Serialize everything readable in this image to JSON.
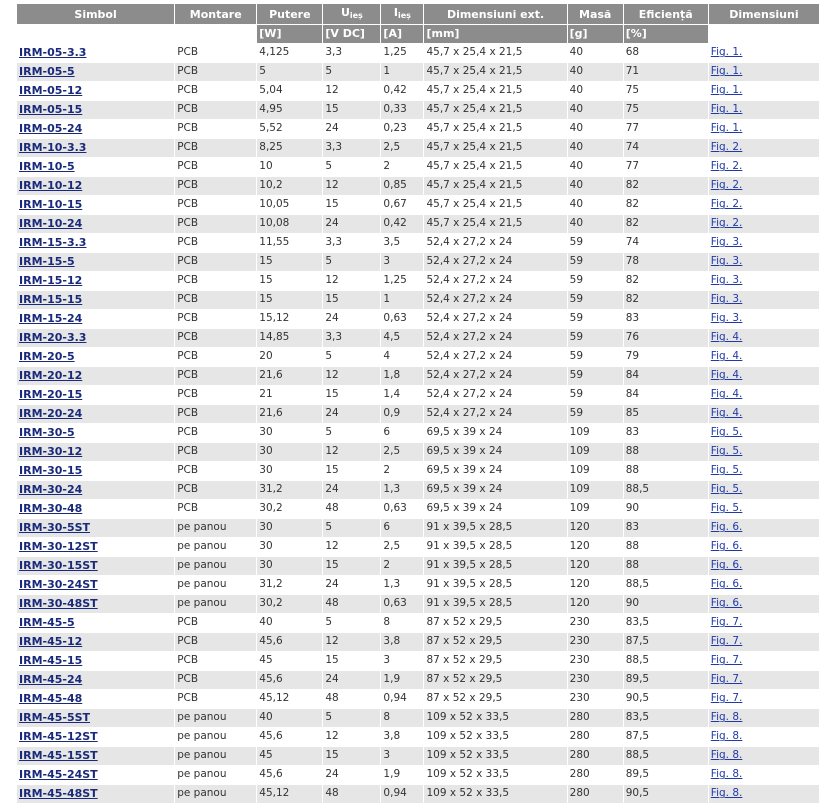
{
  "headers": {
    "simbol": "Simbol",
    "montare": "Montare",
    "putere": "Putere",
    "u_base": "U",
    "u_sub": "ieș",
    "i_base": "I",
    "i_sub": "ieș",
    "dimensiuni_ext": "Dimensiuni ext.",
    "masa": "Masă",
    "eficienta": "Eficiență",
    "dimensiuni": "Dimensiuni"
  },
  "units": {
    "putere": "[W]",
    "u": "[V DC]",
    "i": "[A]",
    "dimensiuni_ext": "[mm]",
    "masa": "[g]",
    "eficienta": "[%]"
  },
  "rows": [
    [
      "IRM-05-3.3",
      "PCB",
      "4,125",
      "3,3",
      "1,25",
      "45,7 x 25,4 x 21,5",
      "40",
      "68",
      "Fig. 1."
    ],
    [
      "IRM-05-5",
      "PCB",
      "5",
      "5",
      "1",
      "45,7 x 25,4 x 21,5",
      "40",
      "71",
      "Fig. 1."
    ],
    [
      "IRM-05-12",
      "PCB",
      "5,04",
      "12",
      "0,42",
      "45,7 x 25,4 x 21,5",
      "40",
      "75",
      "Fig. 1."
    ],
    [
      "IRM-05-15",
      "PCB",
      "4,95",
      "15",
      "0,33",
      "45,7 x 25,4 x 21,5",
      "40",
      "75",
      "Fig. 1."
    ],
    [
      "IRM-05-24",
      "PCB",
      "5,52",
      "24",
      "0,23",
      "45,7 x 25,4 x 21,5",
      "40",
      "77",
      "Fig. 1."
    ],
    [
      "IRM-10-3.3",
      "PCB",
      "8,25",
      "3,3",
      "2,5",
      "45,7 x 25,4 x 21,5",
      "40",
      "74",
      "Fig. 2."
    ],
    [
      "IRM-10-5",
      "PCB",
      "10",
      "5",
      "2",
      "45,7 x 25,4 x 21,5",
      "40",
      "77",
      "Fig. 2."
    ],
    [
      "IRM-10-12",
      "PCB",
      "10,2",
      "12",
      "0,85",
      "45,7 x 25,4 x 21,5",
      "40",
      "82",
      "Fig. 2."
    ],
    [
      "IRM-10-15",
      "PCB",
      "10,05",
      "15",
      "0,67",
      "45,7 x 25,4 x 21,5",
      "40",
      "82",
      "Fig. 2."
    ],
    [
      "IRM-10-24",
      "PCB",
      "10,08",
      "24",
      "0,42",
      "45,7 x 25,4 x 21,5",
      "40",
      "82",
      "Fig. 2."
    ],
    [
      "IRM-15-3.3",
      "PCB",
      "11,55",
      "3,3",
      "3,5",
      "52,4 x 27,2 x 24",
      "59",
      "74",
      "Fig. 3."
    ],
    [
      "IRM-15-5",
      "PCB",
      "15",
      "5",
      "3",
      "52,4 x 27,2 x 24",
      "59",
      "78",
      "Fig. 3."
    ],
    [
      "IRM-15-12",
      "PCB",
      "15",
      "12",
      "1,25",
      "52,4 x 27,2 x 24",
      "59",
      "82",
      "Fig. 3."
    ],
    [
      "IRM-15-15",
      "PCB",
      "15",
      "15",
      "1",
      "52,4 x 27,2 x 24",
      "59",
      "82",
      "Fig. 3."
    ],
    [
      "IRM-15-24",
      "PCB",
      "15,12",
      "24",
      "0,63",
      "52,4 x 27,2 x 24",
      "59",
      "83",
      "Fig. 3."
    ],
    [
      "IRM-20-3.3",
      "PCB",
      "14,85",
      "3,3",
      "4,5",
      "52,4 x 27,2 x 24",
      "59",
      "76",
      "Fig. 4."
    ],
    [
      "IRM-20-5",
      "PCB",
      "20",
      "5",
      "4",
      "52,4 x 27,2 x 24",
      "59",
      "79",
      "Fig. 4."
    ],
    [
      "IRM-20-12",
      "PCB",
      "21,6",
      "12",
      "1,8",
      "52,4 x 27,2 x 24",
      "59",
      "84",
      "Fig. 4."
    ],
    [
      "IRM-20-15",
      "PCB",
      "21",
      "15",
      "1,4",
      "52,4 x 27,2 x 24",
      "59",
      "84",
      "Fig. 4."
    ],
    [
      "IRM-20-24",
      "PCB",
      "21,6",
      "24",
      "0,9",
      "52,4 x 27,2 x 24",
      "59",
      "85",
      "Fig. 4."
    ],
    [
      "IRM-30-5",
      "PCB",
      "30",
      "5",
      "6",
      "69,5 x 39 x 24",
      "109",
      "83",
      "Fig. 5."
    ],
    [
      "IRM-30-12",
      "PCB",
      "30",
      "12",
      "2,5",
      "69,5 x 39 x 24",
      "109",
      "88",
      "Fig. 5."
    ],
    [
      "IRM-30-15",
      "PCB",
      "30",
      "15",
      "2",
      "69,5 x 39 x 24",
      "109",
      "88",
      "Fig. 5."
    ],
    [
      "IRM-30-24",
      "PCB",
      "31,2",
      "24",
      "1,3",
      "69,5 x 39 x 24",
      "109",
      "88,5",
      "Fig. 5."
    ],
    [
      "IRM-30-48",
      "PCB",
      "30,2",
      "48",
      "0,63",
      "69,5 x 39 x 24",
      "109",
      "90",
      "Fig. 5."
    ],
    [
      "IRM-30-5ST",
      "pe panou",
      "30",
      "5",
      "6",
      "91 x 39,5 x 28,5",
      "120",
      "83",
      "Fig. 6."
    ],
    [
      "IRM-30-12ST",
      "pe panou",
      "30",
      "12",
      "2,5",
      "91 x 39,5 x 28,5",
      "120",
      "88",
      "Fig. 6."
    ],
    [
      "IRM-30-15ST",
      "pe panou",
      "30",
      "15",
      "2",
      "91 x 39,5 x 28,5",
      "120",
      "88",
      "Fig. 6."
    ],
    [
      "IRM-30-24ST",
      "pe panou",
      "31,2",
      "24",
      "1,3",
      "91 x 39,5 x 28,5",
      "120",
      "88,5",
      "Fig. 6."
    ],
    [
      "IRM-30-48ST",
      "pe panou",
      "30,2",
      "48",
      "0,63",
      "91 x 39,5 x 28,5",
      "120",
      "90",
      "Fig. 6."
    ],
    [
      "IRM-45-5",
      "PCB",
      "40",
      "5",
      "8",
      "87 x 52 x 29,5",
      "230",
      "83,5",
      "Fig. 7."
    ],
    [
      "IRM-45-12",
      "PCB",
      "45,6",
      "12",
      "3,8",
      "87 x 52 x 29,5",
      "230",
      "87,5",
      "Fig. 7."
    ],
    [
      "IRM-45-15",
      "PCB",
      "45",
      "15",
      "3",
      "87 x 52 x 29,5",
      "230",
      "88,5",
      "Fig. 7."
    ],
    [
      "IRM-45-24",
      "PCB",
      "45,6",
      "24",
      "1,9",
      "87 x 52 x 29,5",
      "230",
      "89,5",
      "Fig. 7."
    ],
    [
      "IRM-45-48",
      "PCB",
      "45,12",
      "48",
      "0,94",
      "87 x 52 x 29,5",
      "230",
      "90,5",
      "Fig. 7."
    ],
    [
      "IRM-45-5ST",
      "pe panou",
      "40",
      "5",
      "8",
      "109 x 52 x 33,5",
      "280",
      "83,5",
      "Fig. 8."
    ],
    [
      "IRM-45-12ST",
      "pe panou",
      "45,6",
      "12",
      "3,8",
      "109 x 52 x 33,5",
      "280",
      "87,5",
      "Fig. 8."
    ],
    [
      "IRM-45-15ST",
      "pe panou",
      "45",
      "15",
      "3",
      "109 x 52 x 33,5",
      "280",
      "88,5",
      "Fig. 8."
    ],
    [
      "IRM-45-24ST",
      "pe panou",
      "45,6",
      "24",
      "1,9",
      "109 x 52 x 33,5",
      "280",
      "89,5",
      "Fig. 8."
    ],
    [
      "IRM-45-48ST",
      "pe panou",
      "45,12",
      "48",
      "0,94",
      "109 x 52 x 33,5",
      "280",
      "90,5",
      "Fig. 8."
    ]
  ],
  "colors": {
    "header_bg": "#8c8c8c",
    "row_alt_bg": "#e6e6e6",
    "symbol_link": "#1a2a7a",
    "fig_link": "#1f3aa8"
  }
}
